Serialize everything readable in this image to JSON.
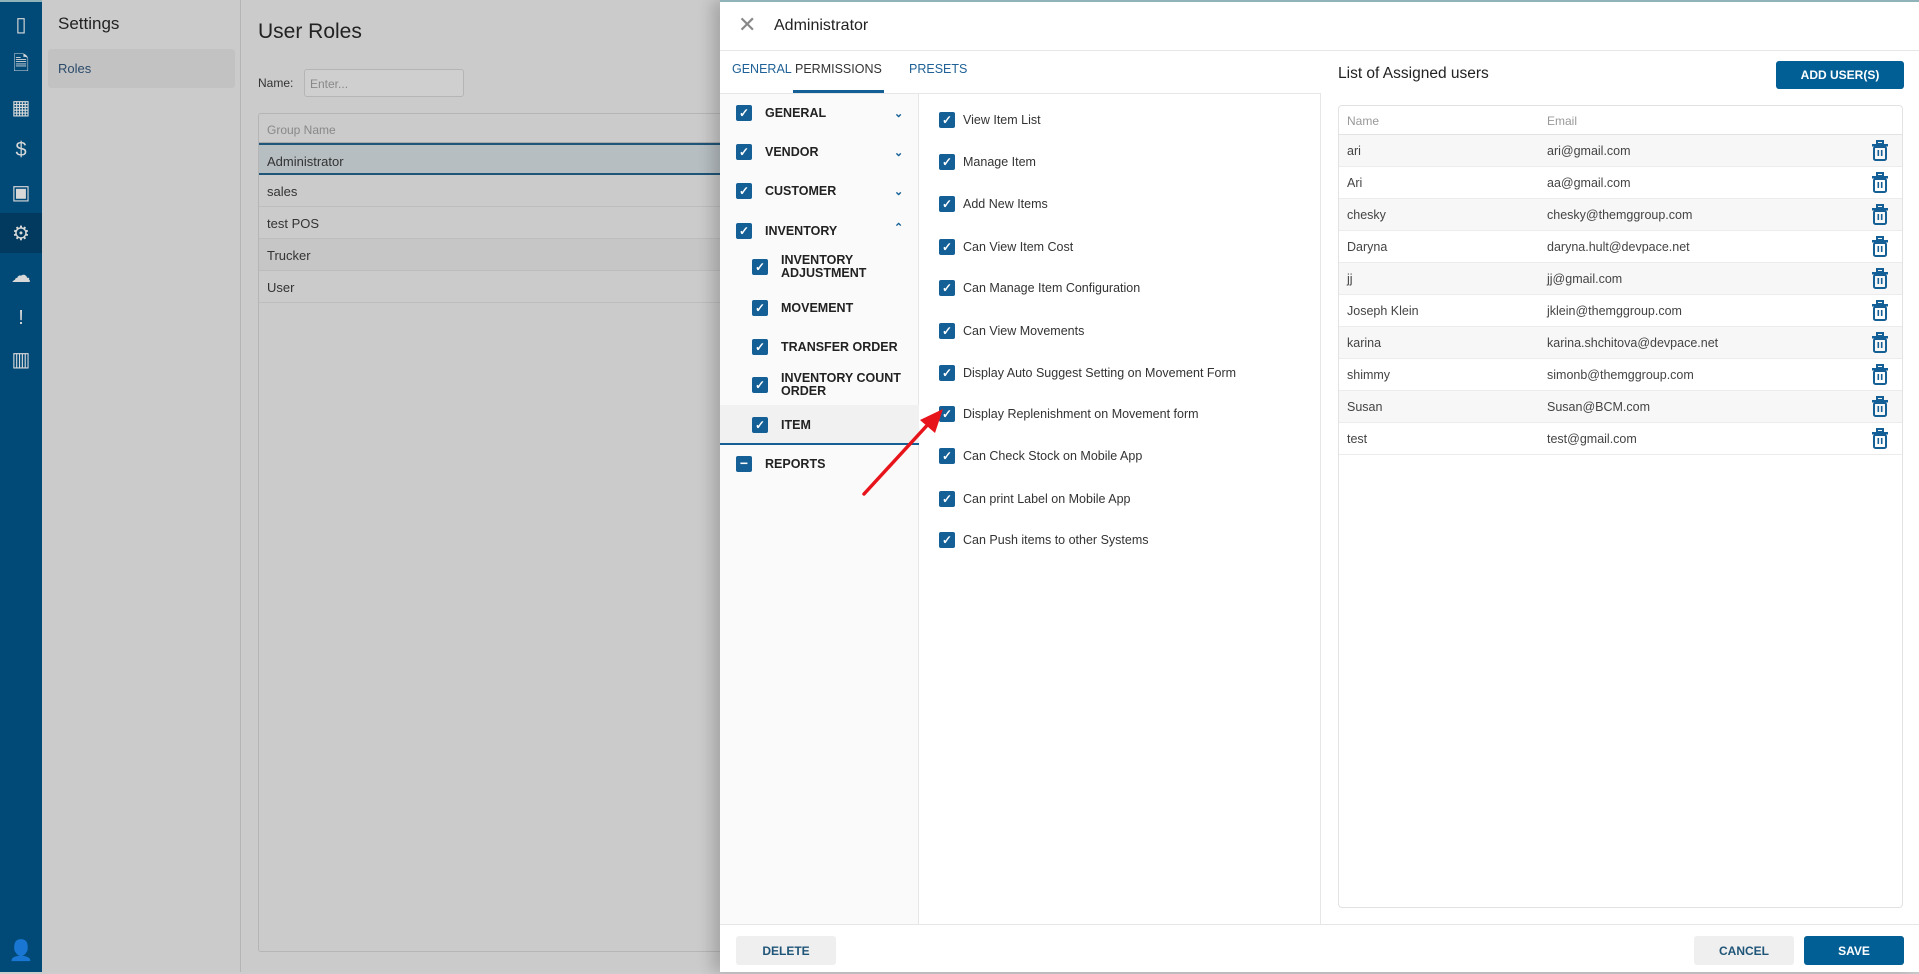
{
  "sidebar": {
    "icons": [
      "book-icon",
      "document-icon",
      "grid-icon",
      "dollar-icon",
      "calendar-icon",
      "gear-icon",
      "cloud-download-icon",
      "alert-file-icon",
      "chart-icon"
    ],
    "active": "gear-icon",
    "user_icon": "user-icon"
  },
  "settings": {
    "title": "Settings",
    "items": [
      {
        "label": "Roles"
      }
    ]
  },
  "main": {
    "title": "User Roles",
    "name_label": "Name:",
    "name_placeholder": "Enter...",
    "table_header": "Group Name",
    "rows": [
      "Administrator",
      "sales",
      "test POS",
      "Trucker",
      "User"
    ],
    "selected": "Administrator"
  },
  "drawer": {
    "title": "Administrator",
    "tabs": [
      "GENERAL",
      "PERMISSIONS",
      "PRESETS"
    ],
    "active_tab": "PERMISSIONS",
    "groups": [
      {
        "label": "GENERAL",
        "checked": true,
        "chevron": "down"
      },
      {
        "label": "VENDOR",
        "checked": true,
        "chevron": "down"
      },
      {
        "label": "CUSTOMER",
        "checked": true,
        "chevron": "down"
      },
      {
        "label": "INVENTORY",
        "checked": true,
        "chevron": "up"
      }
    ],
    "subgroups": [
      "INVENTORY ADJUSTMENT",
      "MOVEMENT",
      "TRANSFER ORDER",
      "INVENTORY COUNT ORDER",
      "ITEM"
    ],
    "selected_subgroup": "ITEM",
    "reports": {
      "label": "REPORTS",
      "state": "indeterminate"
    },
    "permissions": [
      "View Item List",
      "Manage Item",
      "Add New Items",
      "Can View Item Cost",
      "Can Manage Item Configuration",
      "Can View Movements",
      "Display Auto Suggest Setting on Movement Form",
      "Display Replenishment on Movement form",
      "Can Check Stock on Mobile App",
      "Can print Label on Mobile App",
      "Can Push items to other Systems"
    ],
    "users_title": "List of Assigned users",
    "add_users": "ADD USER(S)",
    "users_headers": {
      "name": "Name",
      "email": "Email"
    },
    "users": [
      {
        "name": "ari",
        "email": "ari@gmail.com"
      },
      {
        "name": "Ari",
        "email": "aa@gmail.com"
      },
      {
        "name": "chesky",
        "email": "chesky@themggroup.com"
      },
      {
        "name": "Daryna",
        "email": "daryna.hult@devpace.net"
      },
      {
        "name": "jj",
        "email": "jj@gmail.com"
      },
      {
        "name": "Joseph Klein",
        "email": "jklein@themggroup.com"
      },
      {
        "name": "karina",
        "email": "karina.shchitova@devpace.net"
      },
      {
        "name": "shimmy",
        "email": "simonb@themggroup.com"
      },
      {
        "name": "Susan",
        "email": "Susan@BCM.com"
      },
      {
        "name": "test",
        "email": "test@gmail.com"
      }
    ],
    "delete": "DELETE",
    "cancel": "CANCEL",
    "save": "SAVE"
  },
  "colors": {
    "accent": "#015f96",
    "sidebar": "#014a78",
    "annotation_arrow": "#e8141b"
  }
}
